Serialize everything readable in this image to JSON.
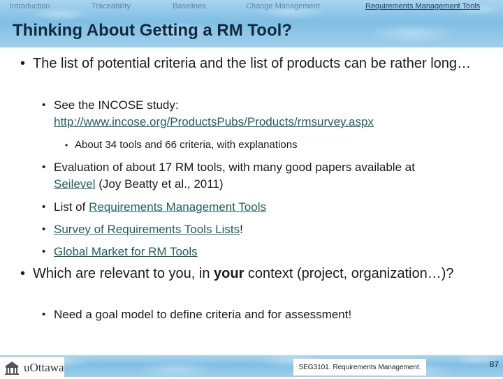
{
  "nav": {
    "items": [
      "Introduction",
      "Traceability",
      "Baselines",
      "Change Management",
      "Requirements Management Tools"
    ],
    "active": "Requirements Management Tools"
  },
  "slide": {
    "title": "Thinking About Getting a RM Tool?",
    "bullet1": "The list of potential criteria and the list of products can be rather long…",
    "incose_prefix": "See the INCOSE study:",
    "incose_link": "http://www.incose.org/ProductsPubs/Products/rmsurvey.aspx",
    "incose_sub": "About 34 tools and 66 criteria, with explanations",
    "eval_prefix": "Evaluation of about 17 RM tools, with many good papers available at",
    "eval_link": "Seilevel",
    "eval_suffix": " (Joy Beatty et al., 2011)",
    "list_prefix": "List of ",
    "list_link": "Requirements Management Tools",
    "survey_link": "Survey of Requirements Tools Lists",
    "survey_suffix": "!",
    "global_link": "Global Market for RM Tools",
    "bullet2_before": "Which are relevant to you, in ",
    "bullet2_bold": "your",
    "bullet2_after": " context (project, organization…)?",
    "goal": "Need a goal model to define criteria and for assessment!"
  },
  "footer": {
    "logo_text": "uOttawa",
    "course": "SEG3101.  Requirements Management.",
    "page": "87"
  },
  "colors": {
    "link": "#1f5f5f",
    "title": "#112a3e",
    "nav_inactive": "#5f86a6"
  },
  "icons": {
    "bullet": "bullet-dot",
    "logo": "uottawa-building-icon"
  }
}
